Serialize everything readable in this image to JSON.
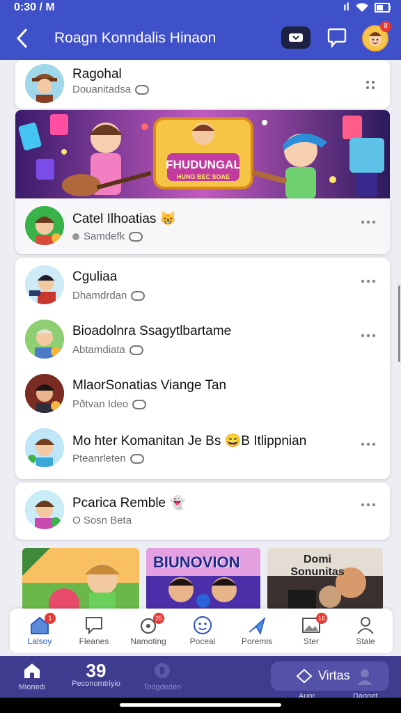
{
  "status_bar": {
    "time": "0:30 / M",
    "signal": "ıl"
  },
  "app_bar": {
    "title": "Roagn Konndalis Hinaon",
    "notification_count": "8"
  },
  "top_card": {
    "name": "Ragohal",
    "subtitle": "Douanitadsa"
  },
  "banner": {
    "text_main": "FHUDUNGAL",
    "text_sub": "HUNG BEC SOAE"
  },
  "featured_row": {
    "name": "Catel Ilhoatias",
    "emoji": "😸",
    "subtitle": "Samdefk"
  },
  "list": [
    {
      "name": "Cguliaa",
      "subtitle": "Dhamdrdan"
    },
    {
      "name": "Bioadolnra Ssagytlbartame",
      "subtitle": "Abtamdiata"
    },
    {
      "name": "MlaorSonatias Viange Tan",
      "subtitle": "Pðtvan Ideo"
    },
    {
      "name": "Mo hter Komanitan Je Bs 😄B Itlippnian",
      "subtitle": "Pteanrleten"
    }
  ],
  "single_card": {
    "name": "Pcarica Remble",
    "emoji": "👻",
    "subtitle": "O Sosn Beta"
  },
  "tiles": [
    {
      "text": ""
    },
    {
      "text": "BIUNOVION"
    },
    {
      "text": "Domi Sonunitas"
    }
  ],
  "bottom_tabs": [
    {
      "label": "Lalsoy",
      "icon": "home-icon",
      "badge": "1"
    },
    {
      "label": "Fleanes",
      "icon": "message-icon",
      "badge": ""
    },
    {
      "label": "Namoting",
      "icon": "refresh-icon",
      "badge": "25"
    },
    {
      "label": "Poceal",
      "icon": "face-icon",
      "badge": ""
    },
    {
      "label": "Poremis",
      "icon": "send-icon",
      "badge": ""
    },
    {
      "label": "Ster",
      "icon": "image-icon",
      "badge": "16"
    },
    {
      "label": "Stale",
      "icon": "person-icon",
      "badge": ""
    }
  ],
  "nav_bar": {
    "home_label": "Mionedi",
    "count": "39",
    "count_label": "Peconomtriyio",
    "third_label": "Todgdeden",
    "pill_label": "Virtas",
    "pill_sub": "Aunr",
    "last_label": "Daonet"
  },
  "colors": {
    "primary": "#3f51c8",
    "nav": "#3e3c8f",
    "badge": "#e53935"
  }
}
